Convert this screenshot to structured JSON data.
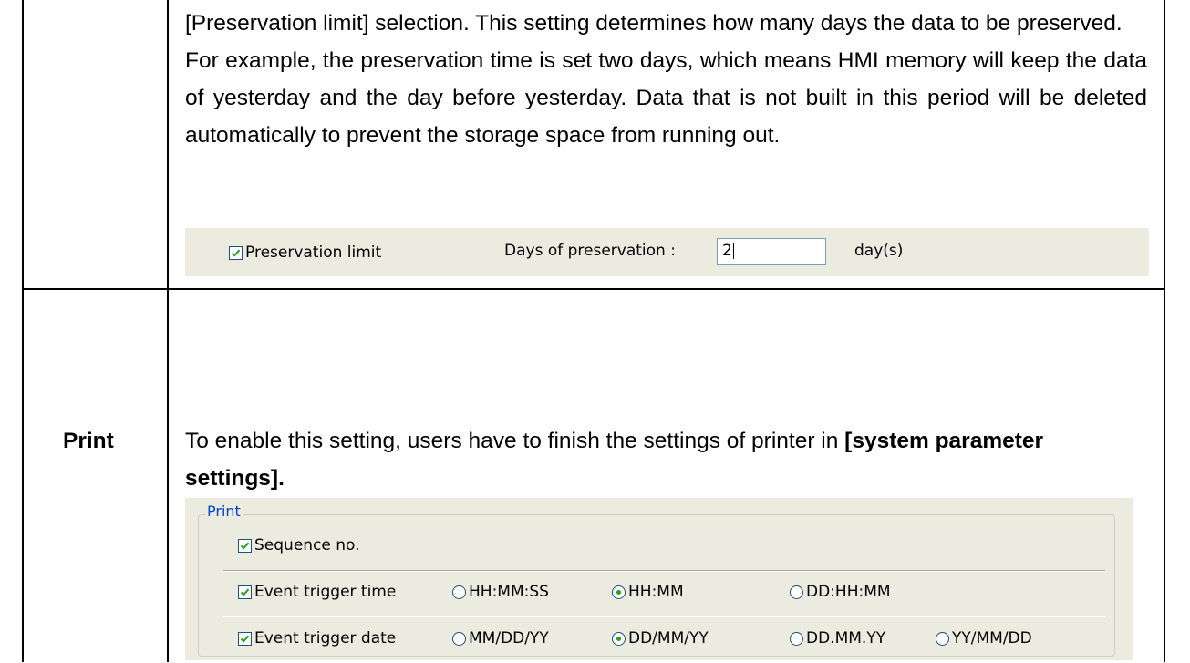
{
  "rows": [
    {
      "label": "",
      "paragraphs": [
        "[Preservation limit] selection. This setting determines how many days the data to be preserved.",
        "For example, the preservation time is set two days, which means HMI memory will keep the data of yesterday and the day before yesterday. Data that is not built in this period will be deleted automatically to prevent the storage space from running out."
      ],
      "panel": {
        "checkbox_label": "Preservation limit",
        "checked": true,
        "days_label": "Days of preservation :",
        "days_value": "2",
        "unit_label": "day(s)"
      }
    },
    {
      "label": "Print",
      "text_prefix": "To enable this setting, users have to finish the settings of printer in ",
      "text_bold": "[system parameter settings].",
      "panel": {
        "group_title": "Print",
        "sequence_label": "Sequence no.",
        "time_label": "Event trigger time",
        "time_options": [
          "HH:MM:SS",
          "HH:MM",
          "DD:HH:MM"
        ],
        "time_selected": "HH:MM",
        "date_label": "Event trigger date",
        "date_options": [
          "MM/DD/YY",
          "DD/MM/YY",
          "DD.MM.YY",
          "YY/MM/DD"
        ],
        "date_selected": "DD/MM/YY"
      }
    }
  ],
  "colors": {
    "panel_bg": "#ecebe0",
    "group_title": "#0046d5",
    "radio_dot": "#21a121",
    "check_mark": "#21a121"
  }
}
